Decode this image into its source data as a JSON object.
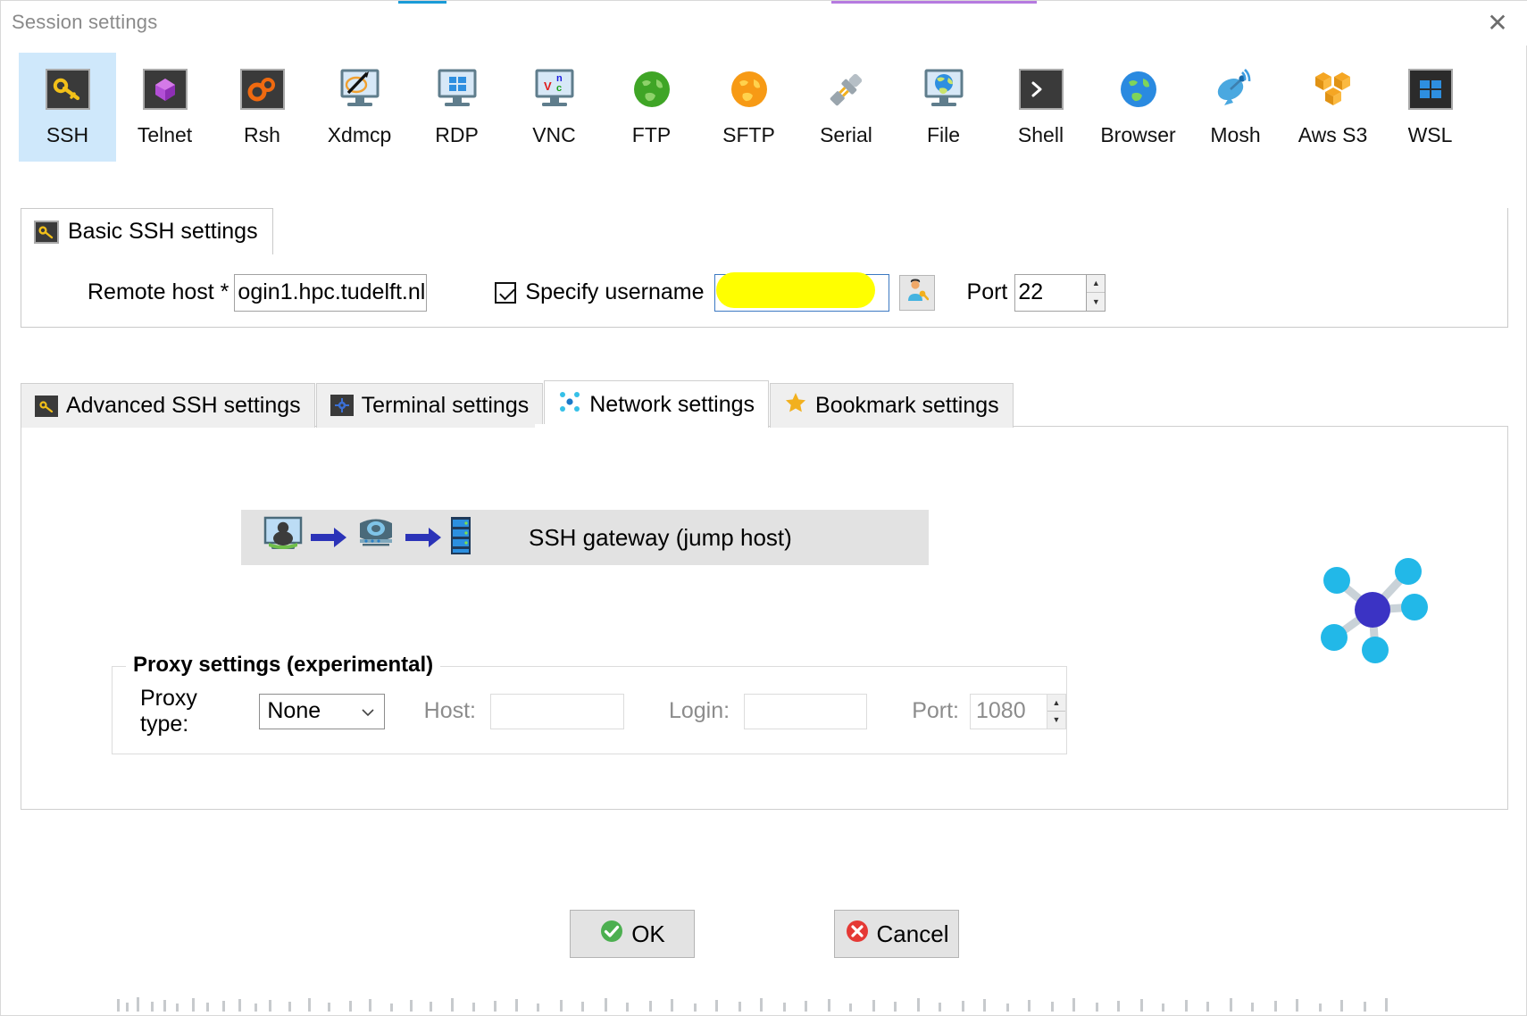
{
  "window": {
    "title": "Session settings",
    "close_label": "✕"
  },
  "session_types": [
    {
      "label": "SSH",
      "icon": "ssh-key-icon",
      "selected": true
    },
    {
      "label": "Telnet",
      "icon": "telnet-crystal-icon",
      "selected": false
    },
    {
      "label": "Rsh",
      "icon": "rsh-gears-icon",
      "selected": false
    },
    {
      "label": "Xdmcp",
      "icon": "xdmcp-monitor-icon",
      "selected": false
    },
    {
      "label": "RDP",
      "icon": "rdp-windows-icon",
      "selected": false
    },
    {
      "label": "VNC",
      "icon": "vnc-monitor-icon",
      "selected": false
    },
    {
      "label": "FTP",
      "icon": "ftp-globe-icon",
      "selected": false
    },
    {
      "label": "SFTP",
      "icon": "sftp-globe-icon",
      "selected": false
    },
    {
      "label": "Serial",
      "icon": "serial-plug-icon",
      "selected": false
    },
    {
      "label": "File",
      "icon": "file-monitor-icon",
      "selected": false
    },
    {
      "label": "Shell",
      "icon": "shell-prompt-icon",
      "selected": false
    },
    {
      "label": "Browser",
      "icon": "browser-globe-icon",
      "selected": false
    },
    {
      "label": "Mosh",
      "icon": "mosh-dish-icon",
      "selected": false
    },
    {
      "label": "Aws S3",
      "icon": "aws-s3-cubes-icon",
      "selected": false
    },
    {
      "label": "WSL",
      "icon": "wsl-windows-icon",
      "selected": false
    }
  ],
  "basic": {
    "tab_label": "Basic SSH settings",
    "remote_host_label": "Remote host *",
    "remote_host_value": "ogin1.hpc.tudelft.nl",
    "specify_username_label": "Specify username",
    "specify_username_checked": true,
    "username_value": "",
    "port_label": "Port",
    "port_value": "22"
  },
  "subtabs": [
    {
      "label": "Advanced SSH settings",
      "icon": "key-icon",
      "active": false
    },
    {
      "label": "Terminal settings",
      "icon": "terminal-icon",
      "active": false
    },
    {
      "label": "Network settings",
      "icon": "network-icon",
      "active": true
    },
    {
      "label": "Bookmark settings",
      "icon": "star-icon",
      "active": false
    }
  ],
  "network": {
    "gateway_label": "SSH gateway (jump host)",
    "proxy_legend": "Proxy settings (experimental)",
    "proxy_type_label": "Proxy type:",
    "proxy_type_value": "None",
    "host_label": "Host:",
    "host_value": "",
    "login_label": "Login:",
    "login_value": "",
    "port_label": "Port:",
    "port_value": "1080"
  },
  "footer": {
    "ok_label": "OK",
    "cancel_label": "Cancel"
  },
  "colors": {
    "selection": "#cfe8fb",
    "accent_blue": "#1a9bd7",
    "ok_green": "#4caf50",
    "cancel_red": "#e53935",
    "redaction_yellow": "#ffff00",
    "banner_grey": "#e2e2e2"
  }
}
